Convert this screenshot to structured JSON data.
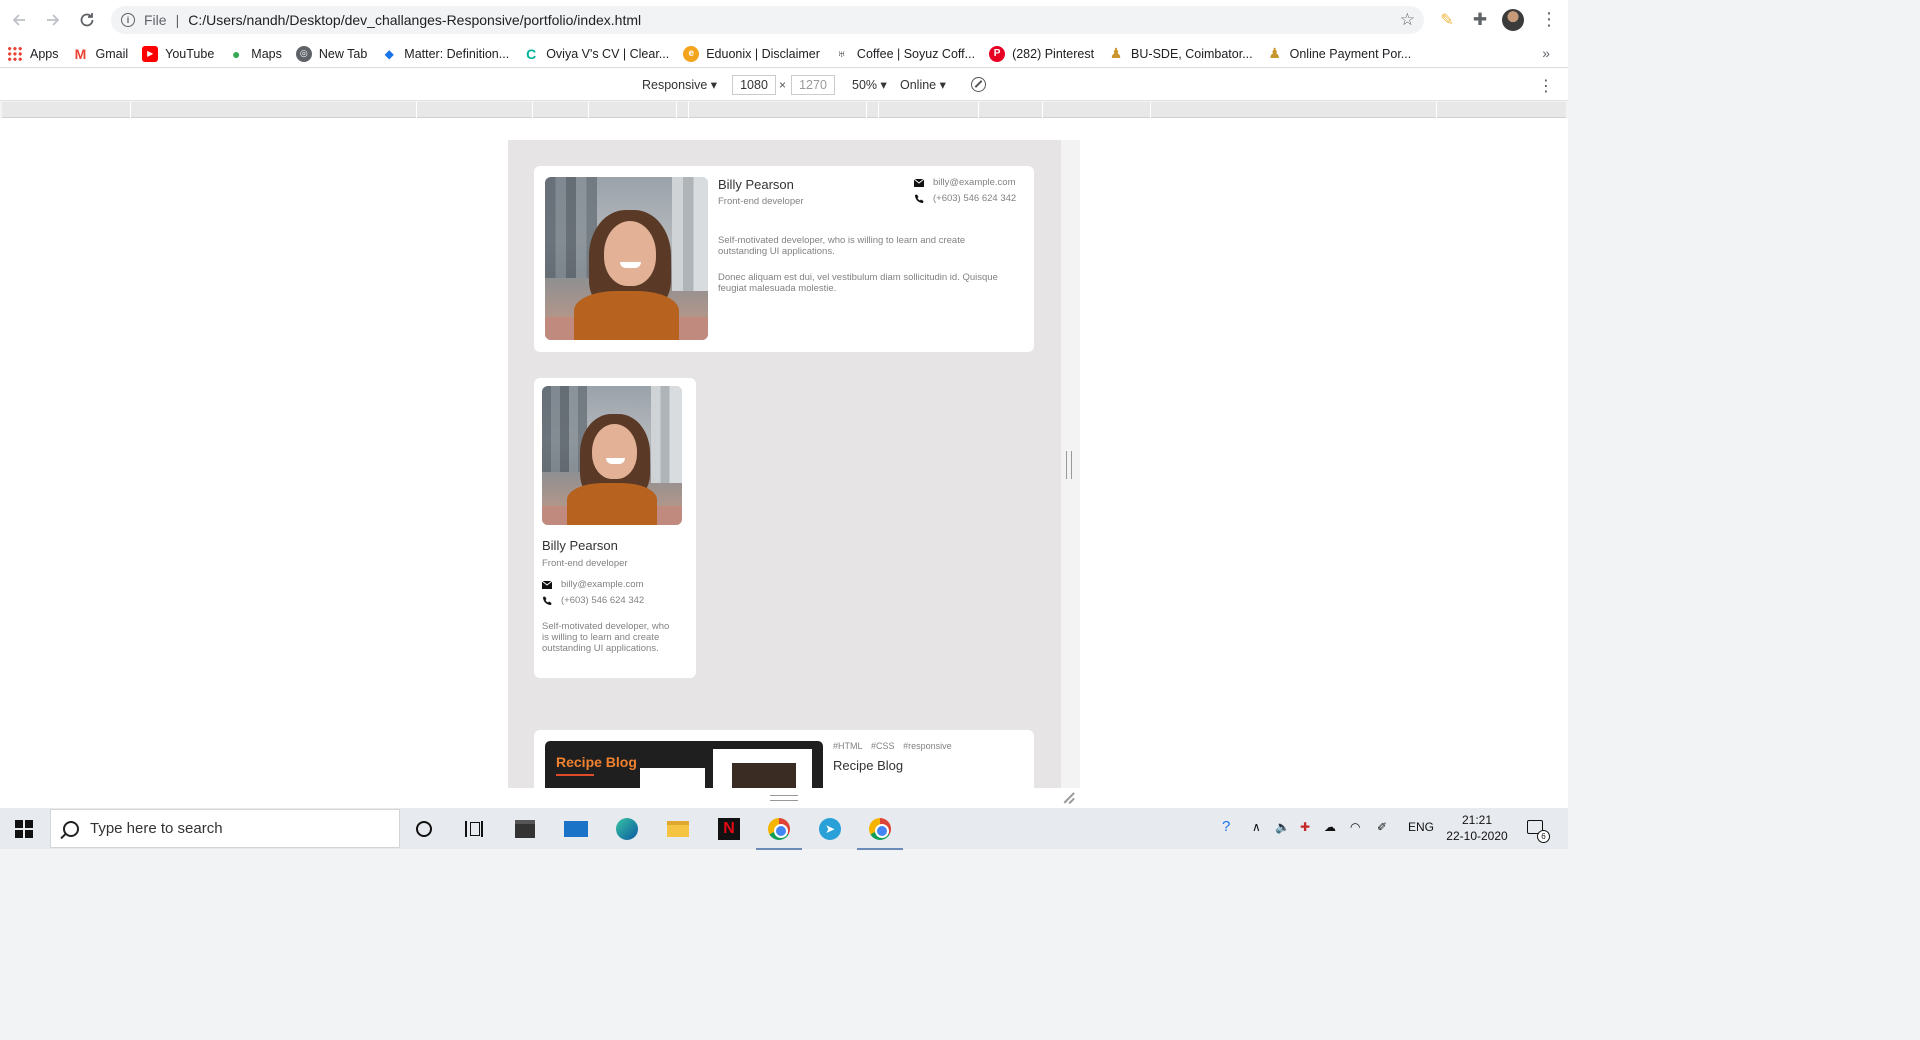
{
  "browser": {
    "scheme_label": "File",
    "url": "C:/Users/nandh/Desktop/dev_challanges-Responsive/portfolio/index.html"
  },
  "bookmarks": [
    {
      "label": "Apps",
      "icon": "apps-grid-icon",
      "color": "#ea4335"
    },
    {
      "label": "Gmail",
      "icon": "gmail-icon",
      "color": "#ea4335"
    },
    {
      "label": "YouTube",
      "icon": "youtube-icon",
      "color": "#ff0000"
    },
    {
      "label": "Maps",
      "icon": "maps-icon",
      "color": "#34a853"
    },
    {
      "label": "New Tab",
      "icon": "globe-icon",
      "color": "#5f6368"
    },
    {
      "label": "Matter: Definition...",
      "icon": "matter-icon",
      "color": "#1a73e8"
    },
    {
      "label": "Oviya V's CV | Clear...",
      "icon": "cv-icon",
      "color": "#00b29b"
    },
    {
      "label": "Eduonix | Disclaimer",
      "icon": "eduonix-icon",
      "color": "#f4a41c"
    },
    {
      "label": "Coffee | Soyuz Coff...",
      "icon": "coffee-icon",
      "color": "#333333"
    },
    {
      "label": "(282) Pinterest",
      "icon": "pinterest-icon",
      "color": "#e60023"
    },
    {
      "label": "BU-SDE, Coimbator...",
      "icon": "user-icon",
      "color": "#c9962e"
    },
    {
      "label": "Online Payment Por...",
      "icon": "user-icon",
      "color": "#c9962e"
    }
  ],
  "device_toolbar": {
    "device": "Responsive",
    "width": "1080",
    "height": "1270",
    "zoom": "50%",
    "throttling": "Online"
  },
  "portfolio": {
    "profile_wide": {
      "name": "Billy Pearson",
      "role": "Front-end developer",
      "email": "billy@example.com",
      "phone": "(+603) 546 624 342",
      "bio_1": "Self-motivated developer, who is willing to learn and create outstanding UI applications.",
      "bio_2": "Donec aliquam est dui, vel vestibulum diam sollicitudin id. Quisque feugiat malesuada molestie."
    },
    "profile_narrow": {
      "name": "Billy Pearson",
      "role": "Front-end developer",
      "email": "billy@example.com",
      "phone": "(+603) 546 624 342",
      "bio": "Self-motivated developer, who is willing to learn and create outstanding UI applications."
    },
    "project": {
      "tags": [
        "#HTML",
        "#CSS",
        "#responsive"
      ],
      "title": "Recipe Blog",
      "thumbnail_title": "Recipe Blog"
    }
  },
  "taskbar": {
    "search_placeholder": "Type here to search",
    "language": "ENG",
    "time": "21:21",
    "date": "22-10-2020",
    "notification_count": "6"
  }
}
